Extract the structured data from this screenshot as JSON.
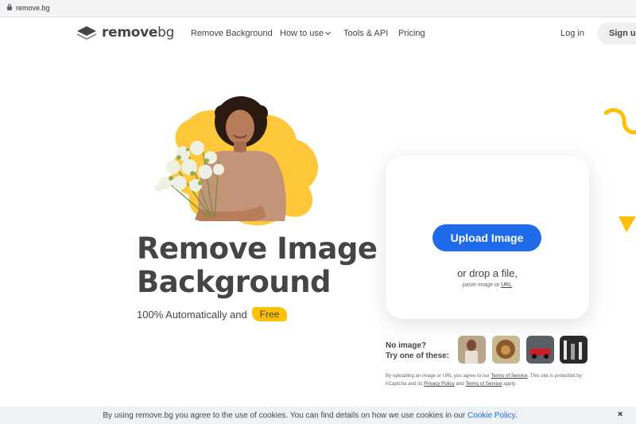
{
  "browser": {
    "url": "remove.bg"
  },
  "header": {
    "logo_main": "remove",
    "logo_bg": "bg",
    "nav": [
      {
        "label": "Remove Background"
      },
      {
        "label": "How to use"
      },
      {
        "label": "Tools & API"
      },
      {
        "label": "Pricing"
      }
    ],
    "login": "Log in",
    "signup": "Sign up"
  },
  "hero": {
    "headline_line1": "Remove Image",
    "headline_line2": "Background",
    "sub": "100% Automatically and",
    "free": "Free"
  },
  "upload": {
    "button": "Upload Image",
    "drop": "or drop a file,",
    "paste_prefix": "paste image or",
    "url_link": "URL"
  },
  "samples": {
    "label_line1": "No image?",
    "label_line2": "Try one of these:",
    "thumbs": [
      "woman-sample",
      "lion-sample",
      "car-sample",
      "product-sample"
    ]
  },
  "terms": {
    "t1": "By uploading an image or URL you agree to our",
    "tos": "Terms of Service",
    "t2": ". This site is protected by hCaptcha and its",
    "privacy": "Privacy Policy",
    "t3": "and",
    "tos2": "Terms of Service",
    "t4": "apply."
  },
  "cookie": {
    "text": "By using remove.bg you agree to the use of cookies. You can find details on how we use cookies in our",
    "link": "Cookie Policy",
    "end": ".",
    "close": "×"
  },
  "colors": {
    "accent": "#1f6bea",
    "yellow": "#ffc107",
    "text": "#454545"
  }
}
